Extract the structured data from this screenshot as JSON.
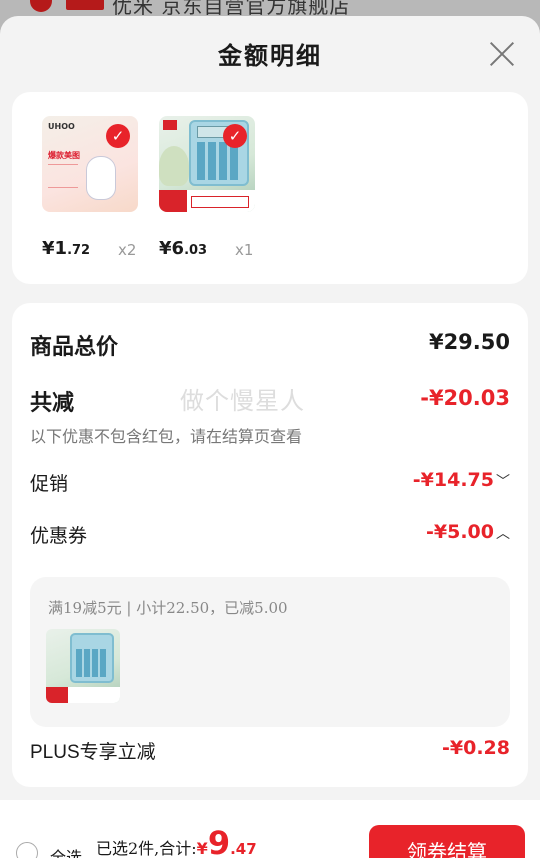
{
  "background": {
    "store_text": "优米 京东自营官方旗舰店"
  },
  "header": {
    "title": "金额明细"
  },
  "products": [
    {
      "price_yuan": "¥1",
      "price_cents": ".72",
      "qty": "x2",
      "name": "pouch"
    },
    {
      "price_yuan": "¥6",
      "price_cents": ".03",
      "qty": "x1",
      "name": "calculator"
    }
  ],
  "detail": {
    "total_label": "商品总价",
    "total_value": "¥29.50",
    "reduce_label": "共减",
    "reduce_value": "-¥20.03",
    "reduce_note": "以下优惠不包含红包，请在结算页查看",
    "promo_label": "促销",
    "promo_value": "-¥14.75",
    "coupon_label": "优惠券",
    "coupon_value": "-¥5.00",
    "coupon_desc": "满19减5元 | 小计22.50，已减5.00",
    "plus_label": "PLUS专享立减",
    "plus_value": "-¥0.28",
    "watermark": "做个慢星人"
  },
  "bottom": {
    "select_all": "全选",
    "summary_prefix": "已选2件,合计:",
    "total_yen": "¥",
    "total_int": "9",
    "total_cents": ".47",
    "checkout": "领券结算"
  },
  "colors": {
    "accent": "#e8232a",
    "sheet_bg": "#f3f3f3"
  }
}
